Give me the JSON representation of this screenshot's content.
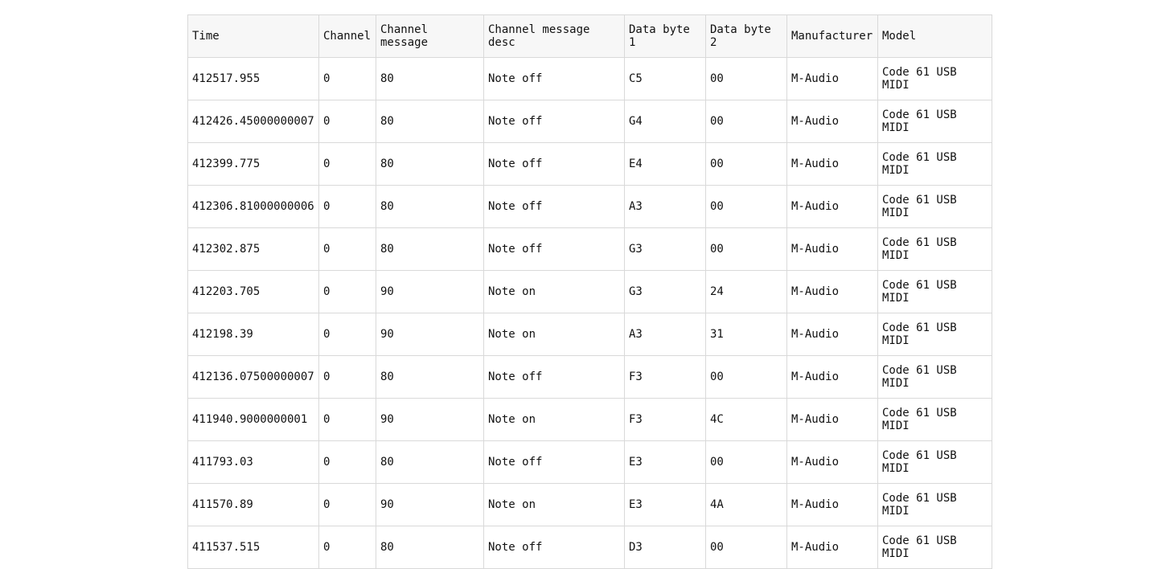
{
  "table": {
    "headers": [
      "Time",
      "Channel",
      "Channel message",
      "Channel message desc",
      "Data byte 1",
      "Data byte 2",
      "Manufacturer",
      "Model"
    ],
    "rows": [
      [
        "412517.955",
        "0",
        "80",
        "Note off",
        "C5",
        "00",
        "M-Audio",
        "Code 61 USB MIDI"
      ],
      [
        "412426.45000000007",
        "0",
        "80",
        "Note off",
        "G4",
        "00",
        "M-Audio",
        "Code 61 USB MIDI"
      ],
      [
        "412399.775",
        "0",
        "80",
        "Note off",
        "E4",
        "00",
        "M-Audio",
        "Code 61 USB MIDI"
      ],
      [
        "412306.81000000006",
        "0",
        "80",
        "Note off",
        "A3",
        "00",
        "M-Audio",
        "Code 61 USB MIDI"
      ],
      [
        "412302.875",
        "0",
        "80",
        "Note off",
        "G3",
        "00",
        "M-Audio",
        "Code 61 USB MIDI"
      ],
      [
        "412203.705",
        "0",
        "90",
        "Note on",
        "G3",
        "24",
        "M-Audio",
        "Code 61 USB MIDI"
      ],
      [
        "412198.39",
        "0",
        "90",
        "Note on",
        "A3",
        "31",
        "M-Audio",
        "Code 61 USB MIDI"
      ],
      [
        "412136.07500000007",
        "0",
        "80",
        "Note off",
        "F3",
        "00",
        "M-Audio",
        "Code 61 USB MIDI"
      ],
      [
        "411940.9000000001",
        "0",
        "90",
        "Note on",
        "F3",
        "4C",
        "M-Audio",
        "Code 61 USB MIDI"
      ],
      [
        "411793.03",
        "0",
        "80",
        "Note off",
        "E3",
        "00",
        "M-Audio",
        "Code 61 USB MIDI"
      ],
      [
        "411570.89",
        "0",
        "90",
        "Note on",
        "E3",
        "4A",
        "M-Audio",
        "Code 61 USB MIDI"
      ],
      [
        "411537.515",
        "0",
        "80",
        "Note off",
        "D3",
        "00",
        "M-Audio",
        "Code 61 USB MIDI"
      ]
    ]
  }
}
